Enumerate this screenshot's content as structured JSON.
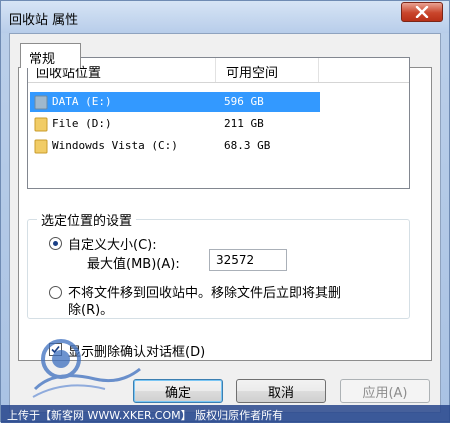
{
  "window": {
    "title": "回收站 属性"
  },
  "tabs": [
    {
      "label": "常规"
    }
  ],
  "list": {
    "headers": {
      "location": "回收站位置",
      "free": "可用空间"
    },
    "rows": [
      {
        "name": "DATA (E:)",
        "free": "596 GB",
        "selected": true
      },
      {
        "name": "File (D:)",
        "free": "211 GB",
        "selected": false
      },
      {
        "name": "Windowds Vista (C:)",
        "free": "68.3 GB",
        "selected": false
      }
    ]
  },
  "settings": {
    "legend": "选定位置的设置",
    "custom_size_label": "自定义大小(C):",
    "max_label": "最大值(MB)(A):",
    "max_value": "32572",
    "no_recycle_line1": "不将文件移到回收站中。移除文件后立即将其删",
    "no_recycle_line2": "除(R)。",
    "custom_checked": true,
    "no_recycle_checked": false
  },
  "confirm_dialog": {
    "label": "显示删除确认对话框(D)",
    "checked": true
  },
  "buttons": {
    "ok": "确定",
    "cancel": "取消",
    "apply": "应用(A)"
  },
  "watermark": {
    "text": "上传于【新客网 WWW.XKER.COM】 版权归原作者所有"
  },
  "icons": {
    "close": "close-icon",
    "folder": "folder-icon",
    "check": "check-icon"
  },
  "colors": {
    "selection": "#3399ff",
    "titlebar": "#b8cdea",
    "close": "#c9452b"
  }
}
